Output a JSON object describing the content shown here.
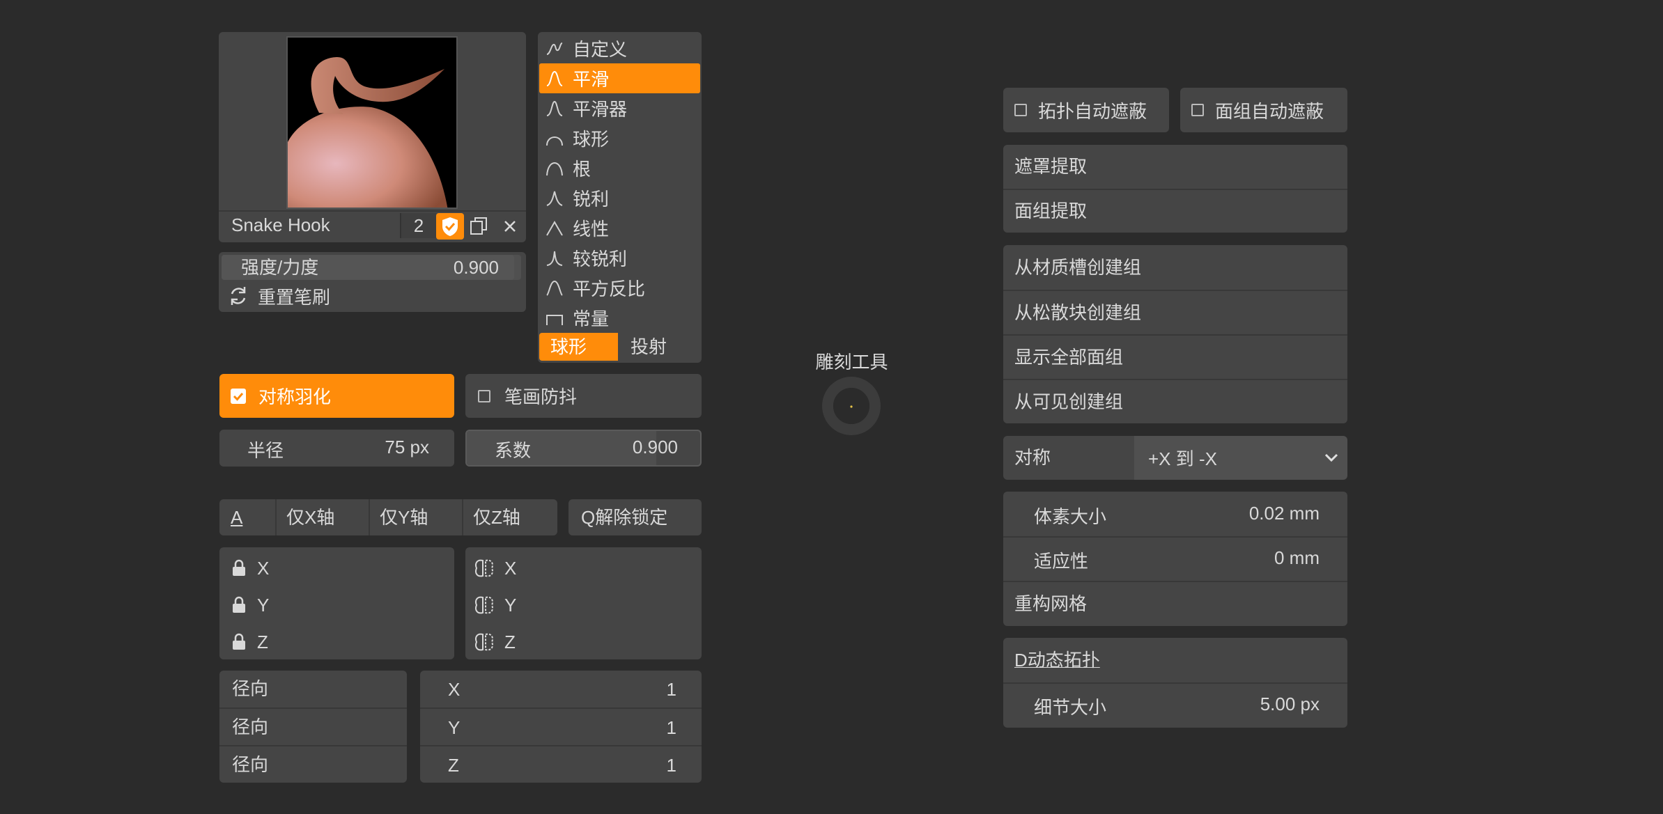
{
  "brush": {
    "name": "Snake Hook",
    "count": "2",
    "strength_label": "强度/力度",
    "strength_value": "0.900",
    "reset_label": "重置笔刷"
  },
  "falloff": {
    "items": [
      {
        "label": "自定义",
        "icon": "custom-curve-icon"
      },
      {
        "label": "平滑",
        "icon": "smooth-curve-icon",
        "selected": true
      },
      {
        "label": "平滑器",
        "icon": "smoother-curve-icon"
      },
      {
        "label": "球形",
        "icon": "sphere-curve-icon"
      },
      {
        "label": "根",
        "icon": "root-curve-icon"
      },
      {
        "label": "锐利",
        "icon": "sharp-curve-icon"
      },
      {
        "label": "线性",
        "icon": "linear-curve-icon"
      },
      {
        "label": "较锐利",
        "icon": "sharper-curve-icon"
      },
      {
        "label": "平方反比",
        "icon": "inverse-square-curve-icon"
      },
      {
        "label": "常量",
        "icon": "constant-curve-icon"
      }
    ],
    "shape_tabs": [
      "球形",
      "投射"
    ]
  },
  "symmetry_feather": "对称羽化",
  "stroke_stabilize": "笔画防抖",
  "radius": {
    "label": "半径",
    "value": "75 px"
  },
  "factor": {
    "label": "系数",
    "value": "0.900"
  },
  "axis_lock": {
    "a": "A",
    "x_only": "仅X轴",
    "y_only": "仅Y轴",
    "z_only": "仅Z轴",
    "q_unlock": "Q解除锁定",
    "lock_labels": [
      "X",
      "Y",
      "Z"
    ],
    "mirror_labels": [
      "X",
      "Y",
      "Z"
    ]
  },
  "radial": {
    "labels": [
      "径向",
      "径向",
      "径向"
    ],
    "axes": [
      "X",
      "Y",
      "Z"
    ],
    "values": [
      "1",
      "1",
      "1"
    ]
  },
  "center": {
    "title": "雕刻工具"
  },
  "right": {
    "topo_automask": "拓扑自动遮蔽",
    "faceset_automask": "面组自动遮蔽",
    "mask_extract": "遮罩提取",
    "faceset_extract": "面组提取",
    "from_material": "从材质槽创建组",
    "from_loose": "从松散块创建组",
    "show_all_facesets": "显示全部面组",
    "from_visible": "从可见创建组",
    "symmetry_label": "对称",
    "symmetry_value": "+X 到 -X",
    "voxel_size_label": "体素大小",
    "voxel_size_value": "0.02 mm",
    "adaptivity_label": "适应性",
    "adaptivity_value": "0 mm",
    "remesh": "重构网格",
    "dyntopo": "D动态拓扑",
    "detail_size_label": "细节大小",
    "detail_size_value": "5.00 px"
  },
  "colors": {
    "accent": "#ff8c0a",
    "panel": "#454545",
    "background": "#2b2b2b"
  }
}
